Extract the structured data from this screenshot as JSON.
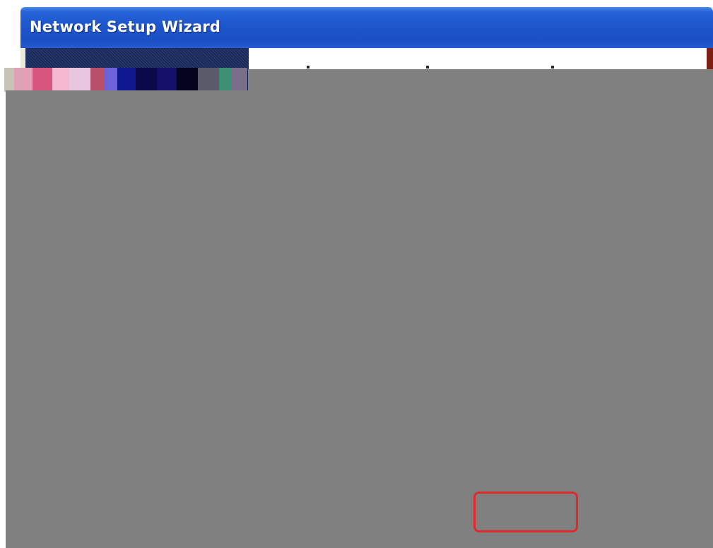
{
  "window": {
    "title": "Network Setup Wizard"
  },
  "colors": {
    "titlebar": "#1f56cc",
    "side_panel": "#101e4a",
    "content_background": "#ffffff",
    "redaction_overlay": "#808080",
    "highlight_border": "#e02a2a"
  },
  "highlight": {
    "label": ""
  }
}
